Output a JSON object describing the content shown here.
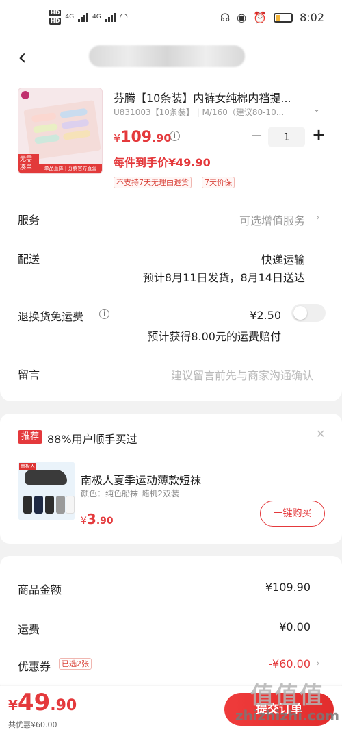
{
  "status_bar": {
    "hd1": "HD",
    "hd2": "HD",
    "net1": "4G",
    "net2": "4G",
    "time": "8:02",
    "battery_level": 0.25
  },
  "product": {
    "title": "芬腾【10条装】内裤女纯棉内裆提...",
    "spec": "U831003【10条装】 | M/160（建议80-10...",
    "price_symbol": "¥",
    "price_int": "109",
    "price_dec": ".90",
    "unit_price": "每件到手价¥49.90",
    "quantity": "1",
    "tags": [
      "不支持7天无理由退货",
      "7天价保"
    ],
    "thumb_tag1": "无需凑单",
    "thumb_tag2": "单品直降 | 芬腾官方直营"
  },
  "rows": {
    "service_label": "服务",
    "service_value": "可选增值服务",
    "delivery_label": "配送",
    "delivery_method": "快递运输",
    "delivery_eta": "预计8月11日发货，8月14日送达",
    "return_label": "退换货免运费",
    "return_price": "¥2.50",
    "return_note": "预计获得8.00元的运费赔付",
    "note_label": "留言",
    "note_placeholder": "建议留言前先与商家沟通确认"
  },
  "recommend": {
    "badge": "推荐",
    "title": "88%用户顺手买过",
    "name": "南极人夏季运动薄款短袜",
    "spec": "颜色：纯色船袜-随机2双装",
    "price_symbol": "¥",
    "price_int": "3",
    "price_dec": ".90",
    "buy_label": "一键购买",
    "img_label": "南极人"
  },
  "summary": {
    "goods_label": "商品金额",
    "goods_value": "¥109.90",
    "shipping_label": "运费",
    "shipping_value": "¥0.00",
    "coupon_label": "优惠券",
    "coupon_tag": "已选2张",
    "coupon_value": "-¥60.00"
  },
  "footer": {
    "total_symbol": "¥",
    "total_int": "49",
    "total_dec": ".90",
    "saved": "共优惠¥60.00",
    "submit_label": "提交订单",
    "watermark1": "值值值",
    "watermark2": "zhizhizhi.com"
  },
  "colors": {
    "accent": "#e4393c",
    "background": "#f2f2f2"
  }
}
